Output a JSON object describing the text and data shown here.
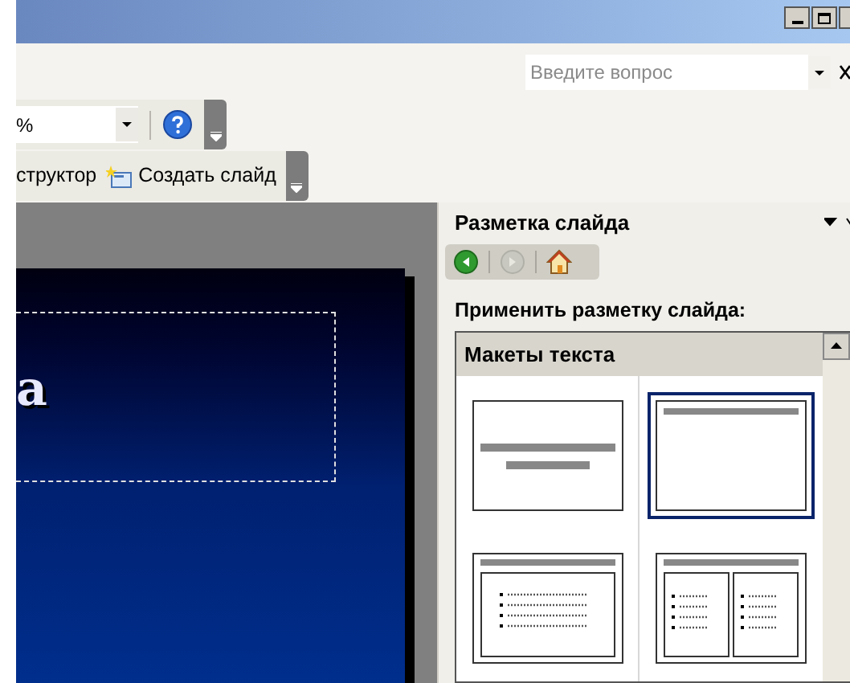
{
  "question_box": {
    "placeholder": "Введите вопрос"
  },
  "zoom_box": {
    "value": "%"
  },
  "toolbar": [
    {
      "kind": "text",
      "label": "структор"
    },
    {
      "kind": "new-slide",
      "label": "Создать слайд"
    }
  ],
  "slide": {
    "title": "а"
  },
  "task_pane": {
    "title": "Разметка слайда",
    "nav": [
      {
        "kind": "back",
        "disabled": false
      },
      {
        "kind": "forward",
        "disabled": true
      },
      {
        "kind": "home",
        "disabled": false
      }
    ],
    "prompt": "Применить разметку слайда:",
    "section": "Макеты текста",
    "layouts": [
      {
        "kind": "title",
        "selected": false
      },
      {
        "kind": "title-only",
        "selected": true
      },
      {
        "kind": "title-text",
        "selected": false
      },
      {
        "kind": "two-columns",
        "selected": false
      }
    ]
  }
}
